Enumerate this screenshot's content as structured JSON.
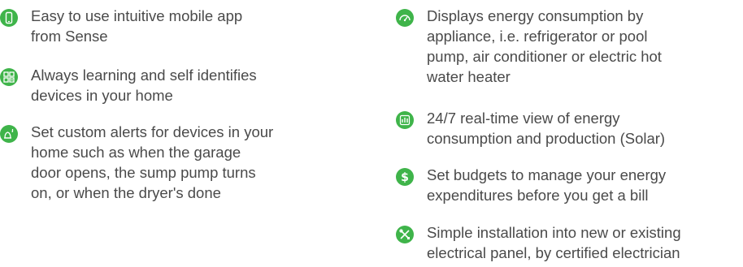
{
  "features_left": [
    {
      "icon": "mobile-phone-icon",
      "text": "Easy to use intuitive mobile app\nfrom Sense"
    },
    {
      "icon": "device-grid-icon",
      "text": "Always learning and self  identifies\ndevices in your home"
    },
    {
      "icon": "alert-bell-icon",
      "text": "Set custom alerts for devices in your\nhome such as when the garage\ndoor opens, the sump pump turns\non, or when the dryer's done"
    }
  ],
  "features_right": [
    {
      "icon": "gauge-icon",
      "text": "Displays energy consumption by\nappliance, i.e. refrigerator or pool\npump, air conditioner or electric hot\nwater heater"
    },
    {
      "icon": "bar-chart-icon",
      "text": "24/7 real-time view of  energy\nconsumption and production (Solar)"
    },
    {
      "icon": "dollar-icon",
      "text": "Set budgets to manage your energy\nexpenditures before you get a bill"
    },
    {
      "icon": "tools-icon",
      "text": "Simple installation into new or existing\nelectrical panel, by certified electrician"
    }
  ],
  "colors": {
    "accent": "#3fb44a",
    "text": "#4a4a4a"
  }
}
